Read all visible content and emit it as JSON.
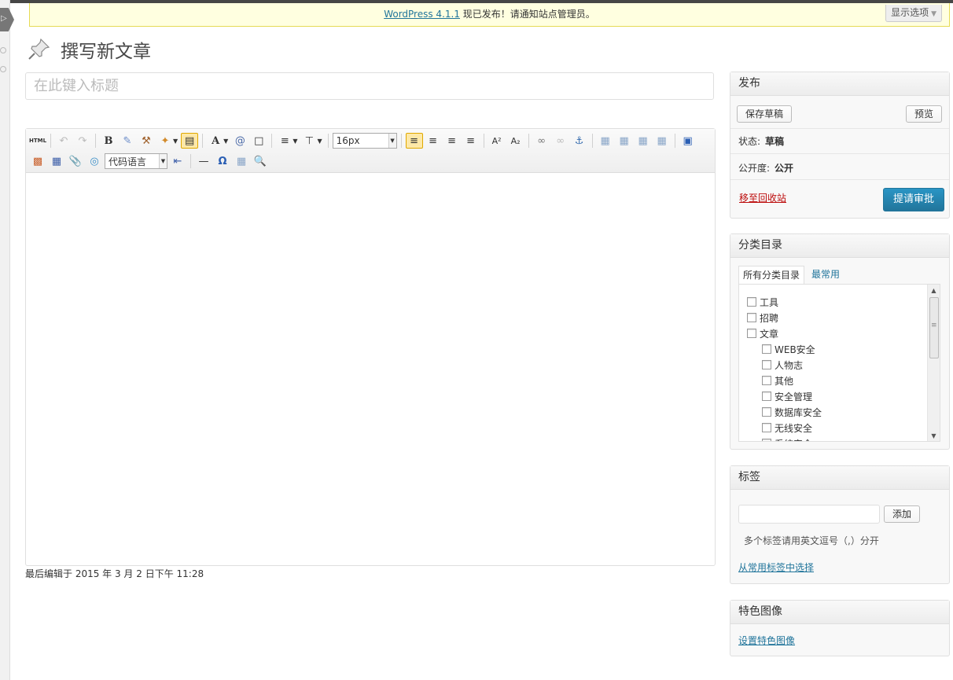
{
  "notice": {
    "link_text": "WordPress 4.1.1",
    "message": "现已发布！请通知站点管理员。",
    "screen_options": "显示选项"
  },
  "page": {
    "title": "撰写新文章",
    "title_placeholder": "在此键入标题",
    "last_edited": "最后编辑于 2015 年 3 月 2 日下午 11:28"
  },
  "toolbar": {
    "html_label": "HTML",
    "bold_label": "B",
    "font_color_label": "A",
    "font_size": "16px",
    "code_language": "代码语言"
  },
  "publish_box": {
    "title": "发布",
    "save_draft": "保存草稿",
    "preview": "预览",
    "status_label": "状态:",
    "status_value": "草稿",
    "visibility_label": "公开度:",
    "visibility_value": "公开",
    "trash": "移至回收站",
    "submit": "提请审批"
  },
  "category_box": {
    "title": "分类目录",
    "tab_all": "所有分类目录",
    "tab_popular": "最常用",
    "items": [
      {
        "label": "工具",
        "child": false
      },
      {
        "label": "招聘",
        "child": false
      },
      {
        "label": "文章",
        "child": false
      },
      {
        "label": "WEB安全",
        "child": true
      },
      {
        "label": "人物志",
        "child": true
      },
      {
        "label": "其他",
        "child": true
      },
      {
        "label": "安全管理",
        "child": true
      },
      {
        "label": "数据库安全",
        "child": true
      },
      {
        "label": "无线安全",
        "child": true
      },
      {
        "label": "系统安全",
        "child": true
      }
    ]
  },
  "tags_box": {
    "title": "标签",
    "add_button": "添加",
    "hint": "多个标签请用英文逗号（,）分开",
    "choose_link": "从常用标签中选择"
  },
  "featured_box": {
    "title": "特色图像",
    "set_link": "设置特色图像"
  }
}
